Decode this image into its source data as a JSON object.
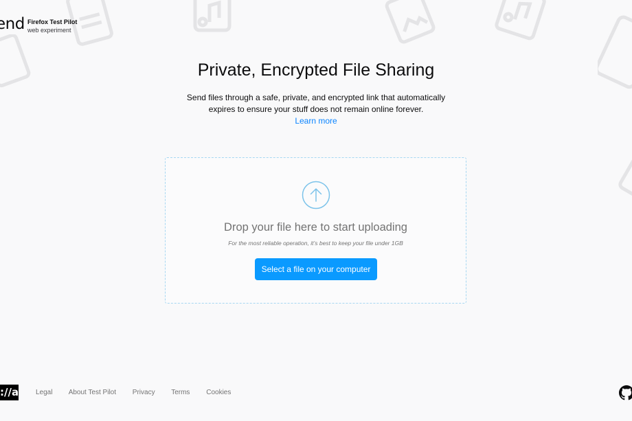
{
  "header": {
    "logo_text": "end",
    "pilot_title": "Firefox Test Pilot",
    "pilot_subtitle": "web experiment"
  },
  "main": {
    "title": "Private, Encrypted File Sharing",
    "description": "Send files through a safe, private, and encrypted link that automatically expires to ensure your stuff does not remain online forever.",
    "learn_more": "Learn more"
  },
  "upload": {
    "drop_title": "Drop your file here to start uploading",
    "drop_note": "For the most reliable operation, it’s best to keep your file under 1GB",
    "button_label": "Select a file on your computer"
  },
  "footer": {
    "moz_logo": "://a",
    "links": [
      "Legal",
      "About Test Pilot",
      "Privacy",
      "Terms",
      "Cookies"
    ]
  },
  "icons": {
    "upload": "upload-arrow-icon",
    "github": "github-icon",
    "background": [
      "music-file-icon",
      "image-file-icon",
      "document-file-icon"
    ]
  },
  "colors": {
    "accent": "#0a9aff",
    "link": "#0a84ff",
    "dropzone_border": "#a6d7f2",
    "background": "#f9f9fa"
  }
}
